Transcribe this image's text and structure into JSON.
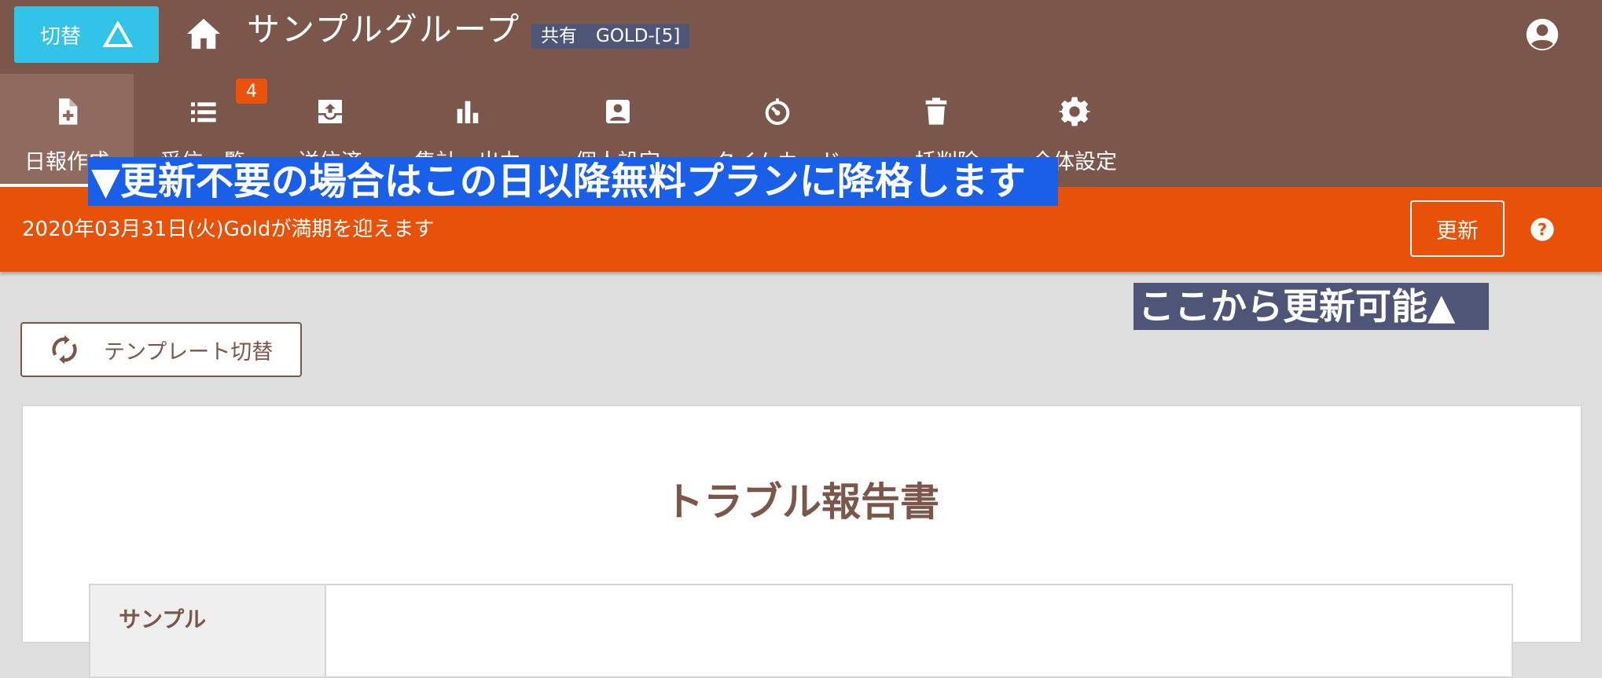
{
  "header": {
    "switch_label": "切替",
    "group_name": "サンプルグループ",
    "badge_shared": "共有",
    "badge_plan": "GOLD-[5]"
  },
  "nav": {
    "items": [
      {
        "label": "日報作成",
        "icon": "file-plus-icon",
        "active": true
      },
      {
        "label": "受信一覧",
        "icon": "list-icon",
        "badge": "4"
      },
      {
        "label": "送信済",
        "icon": "outbox-icon"
      },
      {
        "label": "集計・出力",
        "icon": "bar-chart-icon"
      },
      {
        "label": "個人設定",
        "icon": "account-box-icon"
      },
      {
        "label": "タイムカード",
        "icon": "timer-icon"
      },
      {
        "label": "一括削除",
        "icon": "trash-icon"
      },
      {
        "label": "全体設定",
        "icon": "gear-icon"
      }
    ]
  },
  "annotations": {
    "top": "▼更新不要の場合はこの日以降無料プランに降格します",
    "right": "ここから更新可能▲"
  },
  "notice": {
    "text": "2020年03月31日(火)Goldが満期を迎えます",
    "renew_label": "更新"
  },
  "template_button": {
    "label": "テンプレート切替"
  },
  "report": {
    "title": "トラブル報告書",
    "first_row_label": "サンプル"
  },
  "colors": {
    "header_bg": "#7b564a",
    "notice_bg": "#e85208",
    "accent_cyan": "#33c3e6",
    "badge_bg": "#4f5577",
    "overlay_blue": "#1a5fe8"
  }
}
